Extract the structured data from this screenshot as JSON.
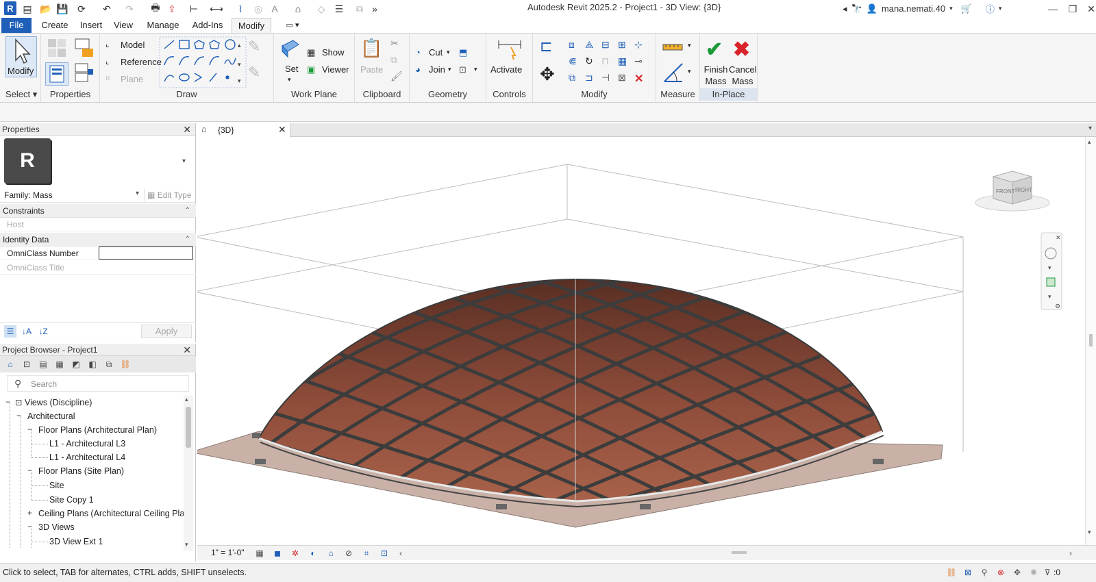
{
  "app": {
    "logo_letter": "R",
    "title": "Autodesk Revit 2025.2 - Project1 - 3D View: {3D}",
    "user_name": "mana.nemati.40",
    "icons": [
      "open-icon",
      "save-icon",
      "sync-icon",
      "undo-icon",
      "redo-icon",
      "print-icon",
      "measure-icon",
      "dimension-icon",
      "text-icon",
      "home-3d-icon",
      "section-icon",
      "switch-windows-icon",
      "close-hidden-icon",
      "binoculars-icon",
      "user-icon",
      "cart-icon",
      "help-icon"
    ]
  },
  "menu": {
    "tabs": [
      "File",
      "Create",
      "Insert",
      "View",
      "Manage",
      "Add-Ins",
      "Modify"
    ],
    "active": "Modify"
  },
  "ribbon": {
    "select": {
      "modify_label": "Modify",
      "panel_label": "Select ▾"
    },
    "properties": {
      "panel_label": "Properties"
    },
    "draw": {
      "panel_label": "Draw",
      "model_label": "Model",
      "reference_label": "Reference",
      "plane_label": "Plane"
    },
    "work_plane": {
      "panel_label": "Work Plane",
      "set_label": "Set",
      "show_label": "Show",
      "viewer_label": "Viewer"
    },
    "clipboard": {
      "panel_label": "Clipboard",
      "paste_label": "Paste"
    },
    "geometry": {
      "panel_label": "Geometry",
      "cut_label": "Cut",
      "join_label": "Join"
    },
    "controls": {
      "panel_label": "Controls",
      "activate_label": "Activate"
    },
    "modify": {
      "panel_label": "Modify"
    },
    "measure": {
      "panel_label": "Measure"
    },
    "inplace": {
      "panel_label": "In-Place Editor",
      "finish_line1": "Finish",
      "finish_line2": "Mass",
      "cancel_line1": "Cancel",
      "cancel_line2": "Mass"
    }
  },
  "properties": {
    "title": "Properties",
    "type_letter": "R",
    "family_label": "Family: Mass",
    "edit_type_label": "Edit Type",
    "groups": [
      {
        "name": "Constraints",
        "rows": [
          {
            "name": "Host",
            "value": ""
          }
        ]
      },
      {
        "name": "Identity Data",
        "rows": [
          {
            "name": "OmniClass Number",
            "value": ""
          },
          {
            "name": "OmniClass Title",
            "value": ""
          }
        ]
      }
    ],
    "apply_label": "Apply"
  },
  "browser": {
    "title": "Project Browser - Project1",
    "search_placeholder": "Search",
    "tree": [
      {
        "label": "Views (Discipline)",
        "sign": "−",
        "level": 0
      },
      {
        "label": "Architectural",
        "sign": "−",
        "level": 1
      },
      {
        "label": "Floor Plans (Architectural Plan)",
        "sign": "−",
        "level": 2
      },
      {
        "label": "L1 - Architectural L3",
        "sign": "",
        "level": 3
      },
      {
        "label": "L1 - Architectural L4",
        "sign": "",
        "level": 3
      },
      {
        "label": "Floor Plans (Site Plan)",
        "sign": "−",
        "level": 2
      },
      {
        "label": "Site",
        "sign": "",
        "level": 3
      },
      {
        "label": "Site Copy 1",
        "sign": "",
        "level": 3
      },
      {
        "label": "Ceiling Plans (Architectural Ceiling Pla",
        "sign": "+",
        "level": 2
      },
      {
        "label": "3D Views",
        "sign": "−",
        "level": 2
      },
      {
        "label": "3D View Ext 1",
        "sign": "",
        "level": 3
      }
    ]
  },
  "view": {
    "tab_label": "{3D}",
    "scale": "1\" = 1'-0\"",
    "viewcube_front": "FRONT",
    "viewcube_right": "RIGHT"
  },
  "status": {
    "message": "Click to select, TAB for alternates, CTRL adds, SHIFT unselects.",
    "filter_count": ":0"
  },
  "colors": {
    "accent": "#1f5fb8",
    "finish_check": "#1b9a3a",
    "cancel_x": "#d9232a",
    "dome_panel": "#8a4a3a",
    "dome_grid": "#3c3c3c",
    "base_plate": "#c9b1a7"
  }
}
